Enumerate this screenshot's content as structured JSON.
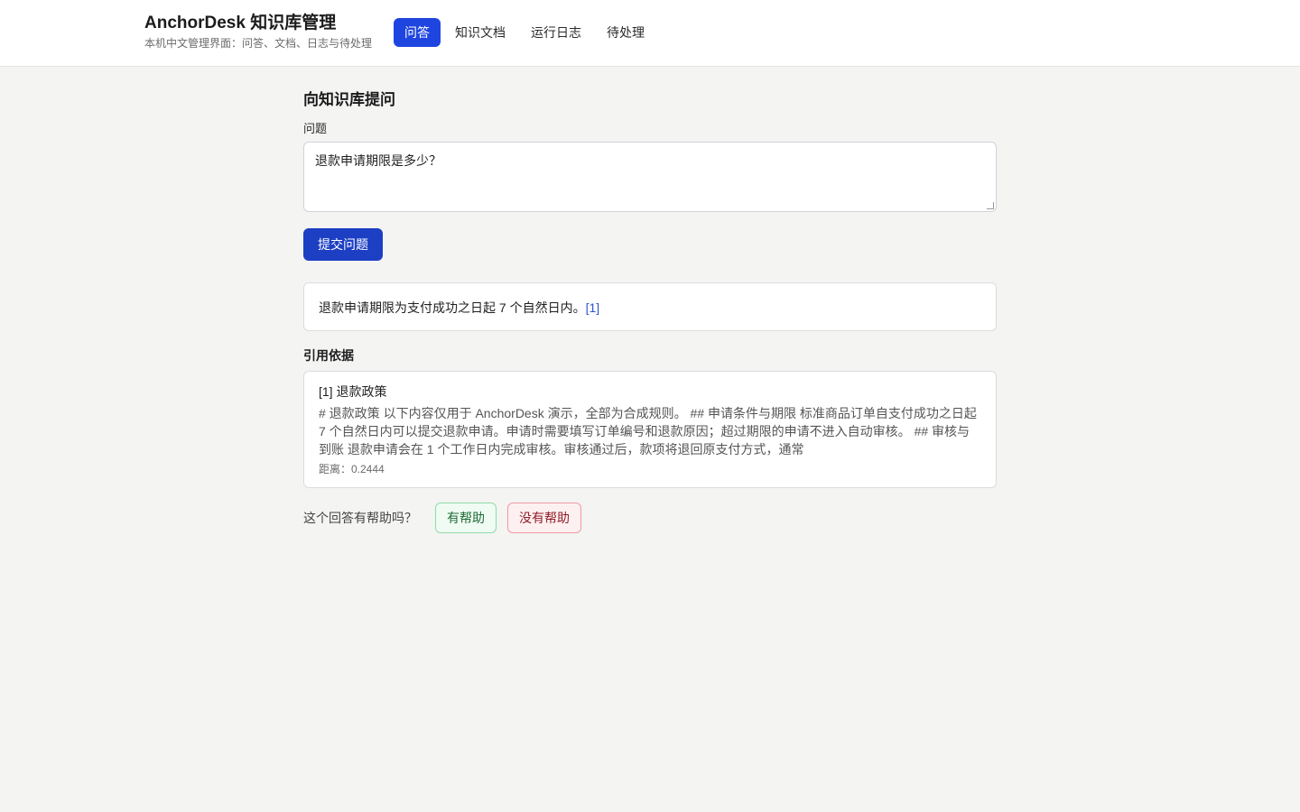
{
  "header": {
    "title": "AnchorDesk 知识库管理",
    "subtitle": "本机中文管理界面：问答、文档、日志与待处理"
  },
  "nav": {
    "items": [
      {
        "label": "问答",
        "active": true
      },
      {
        "label": "知识文档",
        "active": false
      },
      {
        "label": "运行日志",
        "active": false
      },
      {
        "label": "待处理",
        "active": false
      }
    ]
  },
  "ask": {
    "section_title": "向知识库提问",
    "field_label": "问题",
    "question_value": "退款申请期限是多少？",
    "submit_label": "提交问题"
  },
  "answer": {
    "text": "退款申请期限为支付成功之日起 7 个自然日内。",
    "citation_marker": "[1]"
  },
  "citations": {
    "title": "引用依据",
    "items": [
      {
        "heading": "[1] 退款政策",
        "excerpt": "# 退款政策 以下内容仅用于 AnchorDesk 演示，全部为合成规则。 ## 申请条件与期限 标准商品订单自支付成功之日起 7 个自然日内可以提交退款申请。申请时需要填写订单编号和退款原因；超过期限的申请不进入自动审核。 ## 审核与到账 退款申请会在 1 个工作日内完成审核。审核通过后，款项将退回原支付方式，通常",
        "distance": "距离：0.2444"
      }
    ]
  },
  "feedback": {
    "question": "这个回答有帮助吗？",
    "yes_label": "有帮助",
    "no_label": "没有帮助"
  },
  "colors": {
    "accent": "#1f45e0",
    "submit": "#1d3fc4",
    "page_bg": "#f4f4f3"
  }
}
